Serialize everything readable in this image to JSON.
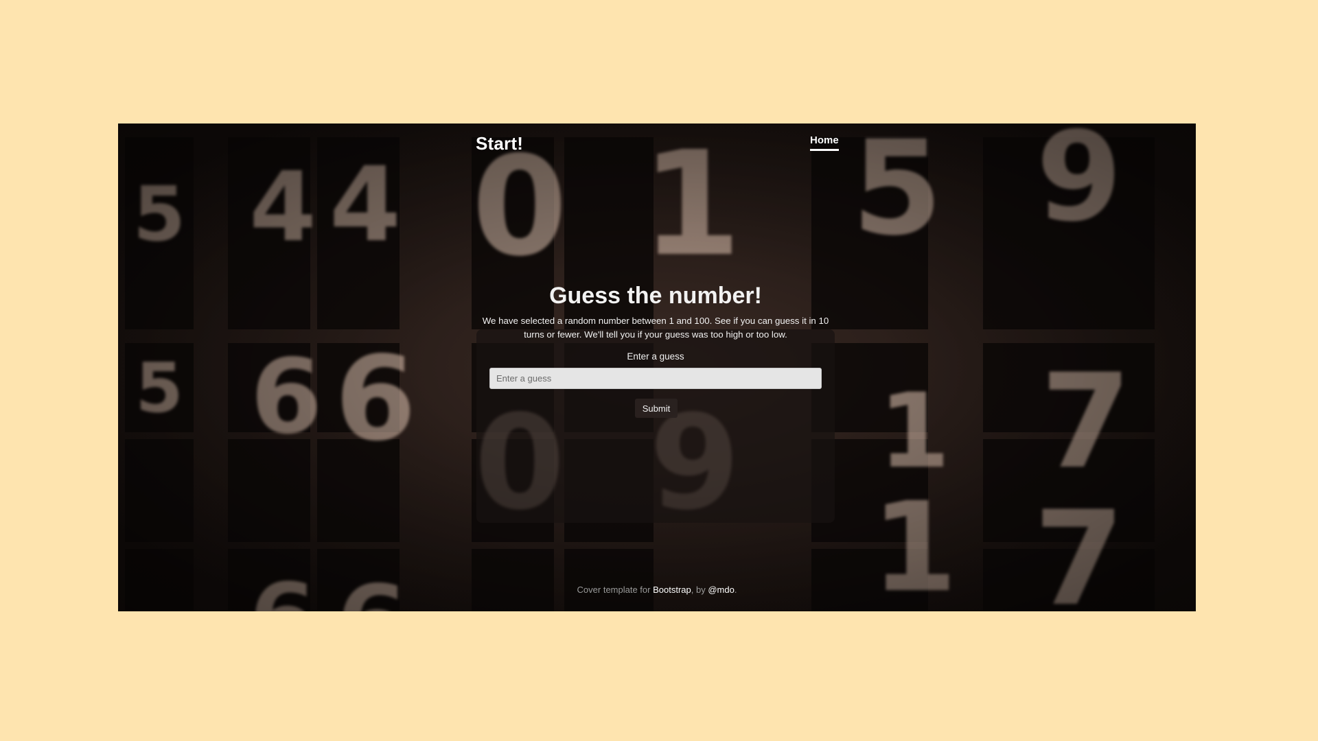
{
  "header": {
    "brand": "Start!",
    "nav": [
      {
        "label": "Home",
        "active": true
      }
    ]
  },
  "main": {
    "title": "Guess the number!",
    "description": "We have selected a random number between 1 and 100. See if you can guess it in 10 turns or fewer. We'll tell you if your guess was too high or too low.",
    "guess_label": "Enter a guess",
    "guess_placeholder": "Enter a guess",
    "guess_value": "",
    "submit_label": "Submit"
  },
  "footer": {
    "prefix": "Cover template for ",
    "link1": "Bootstrap",
    "middle": ", by ",
    "link2": "@mdo",
    "suffix": "."
  },
  "background": {
    "glyphs": [
      "5",
      "4",
      "4",
      "0",
      "1",
      "5",
      "9",
      "5",
      "6",
      "6",
      "0",
      "9",
      "1",
      "7",
      "5",
      "6",
      "6",
      "0",
      "9",
      "1",
      "7"
    ]
  },
  "colors": {
    "page_bg": "#fee4af",
    "frame_bg": "#1c1412",
    "text": "#f2f2f2",
    "muted": "#9a9a9a"
  }
}
